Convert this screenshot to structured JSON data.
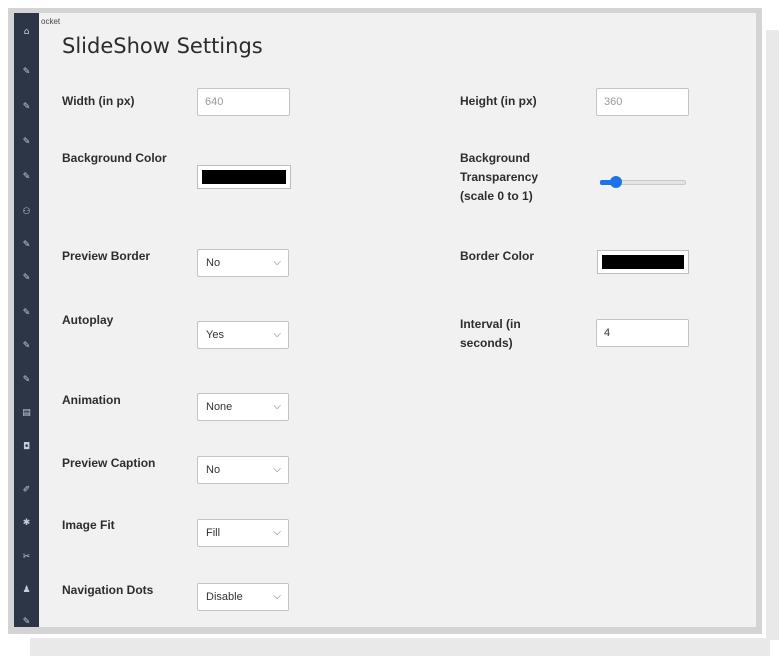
{
  "breadcrumb": "ocket",
  "page_title": "SlideShow Settings",
  "fields": {
    "width": {
      "label": "Width (in px)",
      "value": "640"
    },
    "height": {
      "label": "Height (in px)",
      "value": "360"
    },
    "background_color": {
      "label": "Background Color",
      "value": "#000000"
    },
    "background_transparency": {
      "label_lines": [
        "Background",
        "Transparency",
        "(scale 0 to 1)"
      ],
      "value": 0.15
    },
    "preview_border": {
      "label": "Preview Border",
      "value": "No"
    },
    "border_color": {
      "label": "Border Color",
      "value": "#000000"
    },
    "autoplay": {
      "label": "Autoplay",
      "value": "Yes"
    },
    "interval": {
      "label_lines": [
        "Interval (in",
        "seconds)"
      ],
      "value": "4"
    },
    "animation": {
      "label": "Animation",
      "value": "None"
    },
    "preview_caption": {
      "label": "Preview Caption",
      "value": "No"
    },
    "image_fit": {
      "label": "Image Fit",
      "value": "Fill"
    },
    "navigation_dots": {
      "label": "Navigation Dots",
      "value": "Disable"
    }
  },
  "icons": {
    "chevron": "⌵",
    "sidebar": [
      "home-icon",
      "pin-icon",
      "pin-icon",
      "pin-icon",
      "pin-icon",
      "users-icon",
      "pin-icon",
      "pin-icon",
      "pin-icon",
      "pin-icon",
      "pin-icon",
      "pages-icon",
      "media-icon",
      "brush-icon",
      "gear-icon",
      "tools-icon",
      "user-icon",
      "wrench-icon"
    ]
  },
  "colors": {
    "sidebar": "#2c3647",
    "accent": "#1a73e8"
  }
}
